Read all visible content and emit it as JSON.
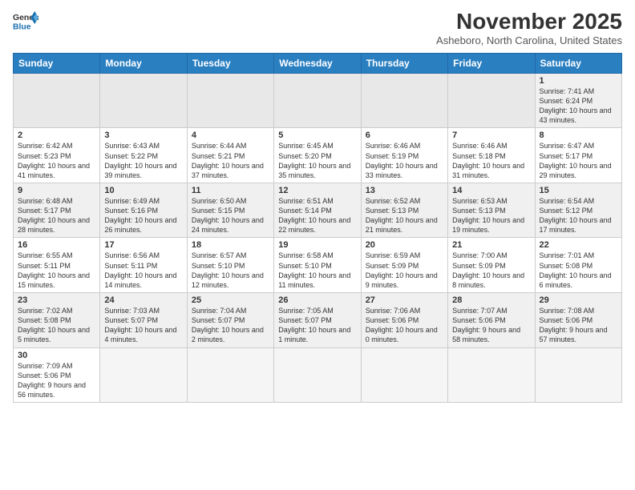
{
  "header": {
    "logo_general": "General",
    "logo_blue": "Blue",
    "month_title": "November 2025",
    "subtitle": "Asheboro, North Carolina, United States"
  },
  "weekdays": [
    "Sunday",
    "Monday",
    "Tuesday",
    "Wednesday",
    "Thursday",
    "Friday",
    "Saturday"
  ],
  "weeks": [
    [
      {
        "day": "",
        "info": ""
      },
      {
        "day": "",
        "info": ""
      },
      {
        "day": "",
        "info": ""
      },
      {
        "day": "",
        "info": ""
      },
      {
        "day": "",
        "info": ""
      },
      {
        "day": "",
        "info": ""
      },
      {
        "day": "1",
        "info": "Sunrise: 7:41 AM\nSunset: 6:24 PM\nDaylight: 10 hours and 43 minutes."
      }
    ],
    [
      {
        "day": "2",
        "info": "Sunrise: 6:42 AM\nSunset: 5:23 PM\nDaylight: 10 hours and 41 minutes."
      },
      {
        "day": "3",
        "info": "Sunrise: 6:43 AM\nSunset: 5:22 PM\nDaylight: 10 hours and 39 minutes."
      },
      {
        "day": "4",
        "info": "Sunrise: 6:44 AM\nSunset: 5:21 PM\nDaylight: 10 hours and 37 minutes."
      },
      {
        "day": "5",
        "info": "Sunrise: 6:45 AM\nSunset: 5:20 PM\nDaylight: 10 hours and 35 minutes."
      },
      {
        "day": "6",
        "info": "Sunrise: 6:46 AM\nSunset: 5:19 PM\nDaylight: 10 hours and 33 minutes."
      },
      {
        "day": "7",
        "info": "Sunrise: 6:46 AM\nSunset: 5:18 PM\nDaylight: 10 hours and 31 minutes."
      },
      {
        "day": "8",
        "info": "Sunrise: 6:47 AM\nSunset: 5:17 PM\nDaylight: 10 hours and 29 minutes."
      }
    ],
    [
      {
        "day": "9",
        "info": "Sunrise: 6:48 AM\nSunset: 5:17 PM\nDaylight: 10 hours and 28 minutes."
      },
      {
        "day": "10",
        "info": "Sunrise: 6:49 AM\nSunset: 5:16 PM\nDaylight: 10 hours and 26 minutes."
      },
      {
        "day": "11",
        "info": "Sunrise: 6:50 AM\nSunset: 5:15 PM\nDaylight: 10 hours and 24 minutes."
      },
      {
        "day": "12",
        "info": "Sunrise: 6:51 AM\nSunset: 5:14 PM\nDaylight: 10 hours and 22 minutes."
      },
      {
        "day": "13",
        "info": "Sunrise: 6:52 AM\nSunset: 5:13 PM\nDaylight: 10 hours and 21 minutes."
      },
      {
        "day": "14",
        "info": "Sunrise: 6:53 AM\nSunset: 5:13 PM\nDaylight: 10 hours and 19 minutes."
      },
      {
        "day": "15",
        "info": "Sunrise: 6:54 AM\nSunset: 5:12 PM\nDaylight: 10 hours and 17 minutes."
      }
    ],
    [
      {
        "day": "16",
        "info": "Sunrise: 6:55 AM\nSunset: 5:11 PM\nDaylight: 10 hours and 15 minutes."
      },
      {
        "day": "17",
        "info": "Sunrise: 6:56 AM\nSunset: 5:11 PM\nDaylight: 10 hours and 14 minutes."
      },
      {
        "day": "18",
        "info": "Sunrise: 6:57 AM\nSunset: 5:10 PM\nDaylight: 10 hours and 12 minutes."
      },
      {
        "day": "19",
        "info": "Sunrise: 6:58 AM\nSunset: 5:10 PM\nDaylight: 10 hours and 11 minutes."
      },
      {
        "day": "20",
        "info": "Sunrise: 6:59 AM\nSunset: 5:09 PM\nDaylight: 10 hours and 9 minutes."
      },
      {
        "day": "21",
        "info": "Sunrise: 7:00 AM\nSunset: 5:09 PM\nDaylight: 10 hours and 8 minutes."
      },
      {
        "day": "22",
        "info": "Sunrise: 7:01 AM\nSunset: 5:08 PM\nDaylight: 10 hours and 6 minutes."
      }
    ],
    [
      {
        "day": "23",
        "info": "Sunrise: 7:02 AM\nSunset: 5:08 PM\nDaylight: 10 hours and 5 minutes."
      },
      {
        "day": "24",
        "info": "Sunrise: 7:03 AM\nSunset: 5:07 PM\nDaylight: 10 hours and 4 minutes."
      },
      {
        "day": "25",
        "info": "Sunrise: 7:04 AM\nSunset: 5:07 PM\nDaylight: 10 hours and 2 minutes."
      },
      {
        "day": "26",
        "info": "Sunrise: 7:05 AM\nSunset: 5:07 PM\nDaylight: 10 hours and 1 minute."
      },
      {
        "day": "27",
        "info": "Sunrise: 7:06 AM\nSunset: 5:06 PM\nDaylight: 10 hours and 0 minutes."
      },
      {
        "day": "28",
        "info": "Sunrise: 7:07 AM\nSunset: 5:06 PM\nDaylight: 9 hours and 58 minutes."
      },
      {
        "day": "29",
        "info": "Sunrise: 7:08 AM\nSunset: 5:06 PM\nDaylight: 9 hours and 57 minutes."
      }
    ],
    [
      {
        "day": "30",
        "info": "Sunrise: 7:09 AM\nSunset: 5:06 PM\nDaylight: 9 hours and 56 minutes."
      },
      {
        "day": "",
        "info": ""
      },
      {
        "day": "",
        "info": ""
      },
      {
        "day": "",
        "info": ""
      },
      {
        "day": "",
        "info": ""
      },
      {
        "day": "",
        "info": ""
      },
      {
        "day": "",
        "info": ""
      }
    ]
  ]
}
